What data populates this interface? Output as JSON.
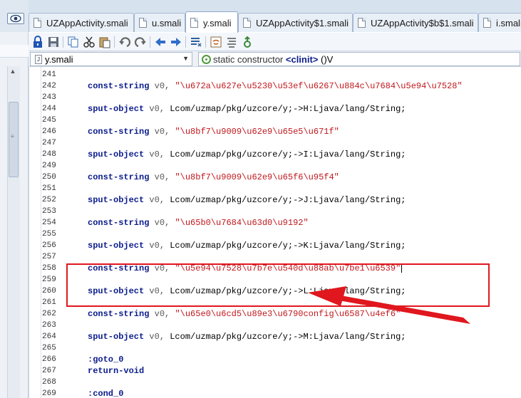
{
  "tabs": [
    {
      "label": "UZAppActivity.smali",
      "active": false
    },
    {
      "label": "u.smali",
      "active": false
    },
    {
      "label": "y.smali",
      "active": true
    },
    {
      "label": "UZAppActivity$1.smali",
      "active": false
    },
    {
      "label": "UZAppActivity$b$1.smali",
      "active": false
    },
    {
      "label": "i.smali",
      "active": false
    }
  ],
  "toolbar": {
    "icons": [
      "lock-icon",
      "save-icon",
      "copy-icon",
      "cut-icon",
      "paste-icon",
      "undo-icon",
      "redo-icon",
      "back-icon",
      "forward-icon",
      "list-icon",
      "java-icon",
      "outline-icon",
      "run-icon"
    ]
  },
  "selector": {
    "file": "y.smali",
    "method_prefix": "static constructor ",
    "method_name": "<clinit>",
    "method_suffix": " ()V"
  },
  "editor": {
    "lines": [
      {
        "no": "241",
        "kw": "",
        "reg": "",
        "str": "",
        "rest": ""
      },
      {
        "no": "242",
        "kw": "const-string",
        "reg": " v0, ",
        "str": "\"\\u672a\\u627e\\u5230\\u53ef\\u6267\\u884c\\u7684\\u5e94\\u7528\"",
        "rest": ""
      },
      {
        "no": "243",
        "kw": "",
        "reg": "",
        "str": "",
        "rest": ""
      },
      {
        "no": "244",
        "kw": "sput-object",
        "reg": " v0, ",
        "str": "",
        "rest": "Lcom/uzmap/pkg/uzcore/y;->H:Ljava/lang/String;"
      },
      {
        "no": "245",
        "kw": "",
        "reg": "",
        "str": "",
        "rest": ""
      },
      {
        "no": "246",
        "kw": "const-string",
        "reg": " v0, ",
        "str": "\"\\u8bf7\\u9009\\u62e9\\u65e5\\u671f\"",
        "rest": ""
      },
      {
        "no": "247",
        "kw": "",
        "reg": "",
        "str": "",
        "rest": ""
      },
      {
        "no": "248",
        "kw": "sput-object",
        "reg": " v0, ",
        "str": "",
        "rest": "Lcom/uzmap/pkg/uzcore/y;->I:Ljava/lang/String;"
      },
      {
        "no": "249",
        "kw": "",
        "reg": "",
        "str": "",
        "rest": ""
      },
      {
        "no": "250",
        "kw": "const-string",
        "reg": " v0, ",
        "str": "\"\\u8bf7\\u9009\\u62e9\\u65f6\\u95f4\"",
        "rest": ""
      },
      {
        "no": "251",
        "kw": "",
        "reg": "",
        "str": "",
        "rest": ""
      },
      {
        "no": "252",
        "kw": "sput-object",
        "reg": " v0, ",
        "str": "",
        "rest": "Lcom/uzmap/pkg/uzcore/y;->J:Ljava/lang/String;"
      },
      {
        "no": "253",
        "kw": "",
        "reg": "",
        "str": "",
        "rest": ""
      },
      {
        "no": "254",
        "kw": "const-string",
        "reg": " v0, ",
        "str": "\"\\u65b0\\u7684\\u63d0\\u9192\"",
        "rest": ""
      },
      {
        "no": "255",
        "kw": "",
        "reg": "",
        "str": "",
        "rest": ""
      },
      {
        "no": "256",
        "kw": "sput-object",
        "reg": " v0, ",
        "str": "",
        "rest": "Lcom/uzmap/pkg/uzcore/y;->K:Ljava/lang/String;"
      },
      {
        "no": "257",
        "kw": "",
        "reg": "",
        "str": "",
        "rest": ""
      },
      {
        "no": "258",
        "kw": "const-string",
        "reg": " v0, ",
        "str": "\"\\u5e94\\u7528\\u7b7e\\u540d\\u88ab\\u7be1\\u6539\"",
        "rest": ""
      },
      {
        "no": "259",
        "kw": "",
        "reg": "",
        "str": "",
        "rest": ""
      },
      {
        "no": "260",
        "kw": "sput-object",
        "reg": " v0, ",
        "str": "",
        "rest": "Lcom/uzmap/pkg/uzcore/y;->L:Ljava/lang/String;"
      },
      {
        "no": "261",
        "kw": "",
        "reg": "",
        "str": "",
        "rest": ""
      },
      {
        "no": "262",
        "kw": "const-string",
        "reg": " v0, ",
        "str": "\"\\u65e0\\u6cd5\\u89e3\\u6790config\\u6587\\u4ef6\"",
        "rest": ""
      },
      {
        "no": "263",
        "kw": "",
        "reg": "",
        "str": "",
        "rest": ""
      },
      {
        "no": "264",
        "kw": "sput-object",
        "reg": " v0, ",
        "str": "",
        "rest": "Lcom/uzmap/pkg/uzcore/y;->M:Ljava/lang/String;"
      },
      {
        "no": "265",
        "kw": "",
        "reg": "",
        "str": "",
        "rest": ""
      },
      {
        "no": "266",
        "kw": ":goto_0",
        "reg": "",
        "str": "",
        "rest": ""
      },
      {
        "no": "267",
        "kw": "return-void",
        "reg": "",
        "str": "",
        "rest": ""
      },
      {
        "no": "268",
        "kw": "",
        "reg": "",
        "str": "",
        "rest": ""
      },
      {
        "no": "269",
        "kw": ":cond_0",
        "reg": "",
        "str": "",
        "rest": ""
      }
    ]
  },
  "annotation": {
    "color": "#e0171e"
  }
}
